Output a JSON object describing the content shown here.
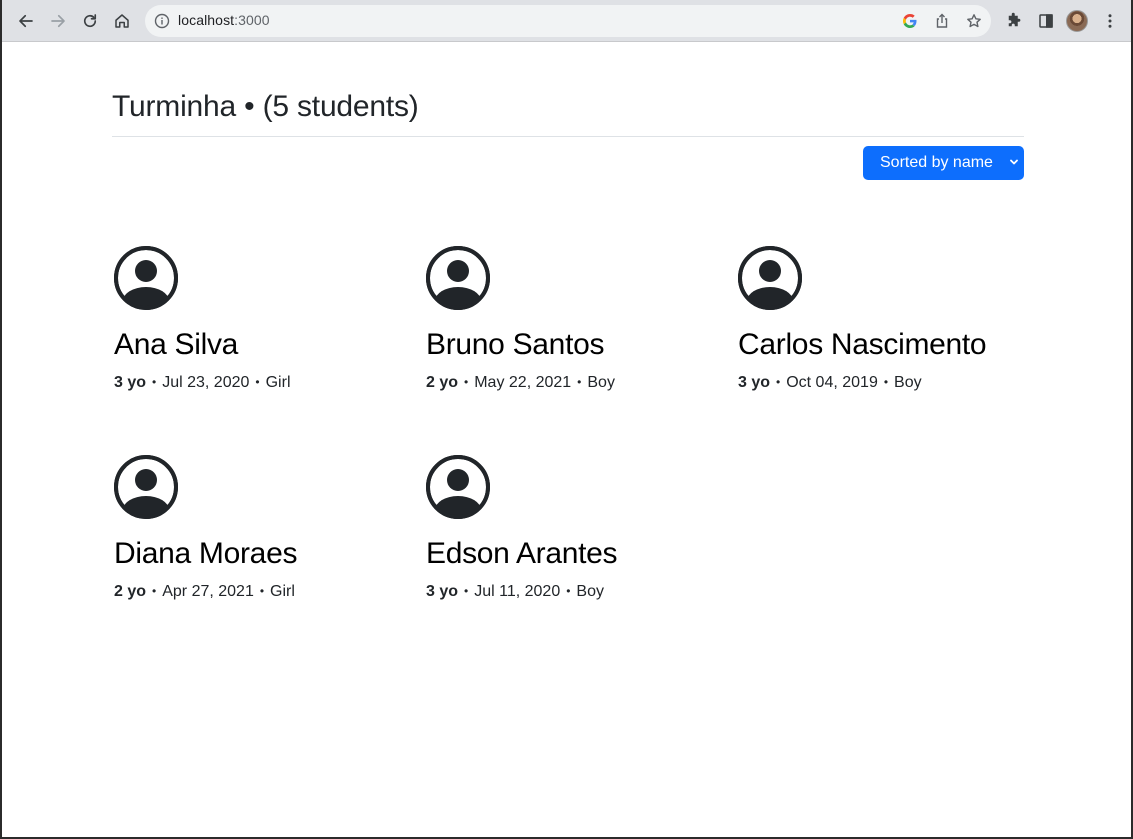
{
  "browser": {
    "url_host": "localhost",
    "url_port": ":3000",
    "icons": [
      "back-icon",
      "forward-icon",
      "reload-icon",
      "home-icon",
      "info-icon",
      "google-icon",
      "share-icon",
      "star-icon",
      "extensions-icon",
      "side-panel-icon",
      "profile-avatar",
      "more-menu-icon"
    ]
  },
  "page": {
    "title": "Turminha",
    "separator": "•",
    "count_label": "(5 students)",
    "sort": {
      "selected": "Sorted by name",
      "accent": "#0d6efd"
    }
  },
  "students": [
    {
      "name": "Ana Silva",
      "age": "3 yo",
      "birthdate": "Jul 23, 2020",
      "gender": "Girl"
    },
    {
      "name": "Bruno Santos",
      "age": "2 yo",
      "birthdate": "May 22, 2021",
      "gender": "Boy"
    },
    {
      "name": "Carlos Nascimento",
      "age": "3 yo",
      "birthdate": "Oct 04, 2019",
      "gender": "Boy"
    },
    {
      "name": "Diana Moraes",
      "age": "2 yo",
      "birthdate": "Apr 27, 2021",
      "gender": "Girl"
    },
    {
      "name": "Edson Arantes",
      "age": "3 yo",
      "birthdate": "Jul 11, 2020",
      "gender": "Boy"
    }
  ]
}
